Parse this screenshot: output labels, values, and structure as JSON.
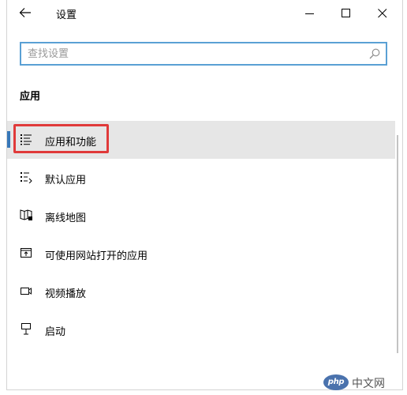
{
  "window": {
    "title": "设置"
  },
  "search": {
    "placeholder": "查找设置",
    "value": ""
  },
  "section": {
    "heading": "应用"
  },
  "nav_items": [
    {
      "label": "应用和功能",
      "icon": "apps-features-icon",
      "selected": true
    },
    {
      "label": "默认应用",
      "icon": "default-apps-icon",
      "selected": false
    },
    {
      "label": "离线地图",
      "icon": "offline-maps-icon",
      "selected": false
    },
    {
      "label": "可使用网站打开的应用",
      "icon": "apps-for-websites-icon",
      "selected": false
    },
    {
      "label": "视频播放",
      "icon": "video-playback-icon",
      "selected": false
    },
    {
      "label": "启动",
      "icon": "startup-icon",
      "selected": false
    }
  ],
  "watermark": {
    "logo_text": "php",
    "site_text": "中文网"
  },
  "colors": {
    "accent": "#3777b8",
    "highlight": "#e03a3a",
    "search_border": "#5aa0d4",
    "selected_bg": "#e6e6e6"
  }
}
